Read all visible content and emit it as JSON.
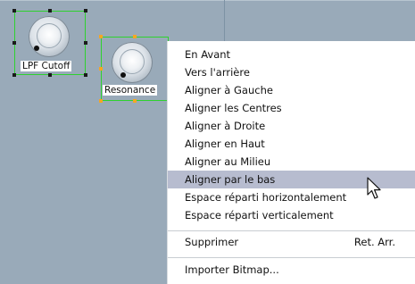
{
  "knobs": [
    {
      "id": "lpf_cutoff",
      "label": "LPF Cutoff",
      "selected": true
    },
    {
      "id": "resonance",
      "label": "Resonance",
      "selected": true
    }
  ],
  "context_menu": {
    "items": [
      {
        "label": "En Avant"
      },
      {
        "label": "Vers l'arrière"
      },
      {
        "label": "Aligner à Gauche"
      },
      {
        "label": "Aligner les Centres"
      },
      {
        "label": "Aligner à Droite"
      },
      {
        "label": "Aligner en Haut"
      },
      {
        "label": "Aligner au Milieu"
      },
      {
        "label": "Aligner par le bas",
        "highlighted": true
      },
      {
        "label": "Espace réparti horizontalement"
      },
      {
        "label": "Espace réparti verticalement"
      },
      {
        "label": "Supprimer",
        "shortcut": "Ret. Arr."
      },
      {
        "label": "Importer Bitmap..."
      }
    ]
  },
  "colors": {
    "canvas": "#99aab9",
    "selection_frame": "#2fd12f",
    "menu_highlight": "#b7bccf"
  },
  "icons": {
    "cursor": "arrow-pointer-icon"
  }
}
